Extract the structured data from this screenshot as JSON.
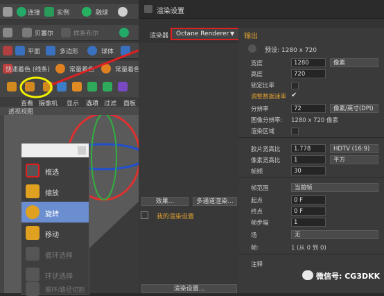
{
  "toolbar": {
    "row1": [
      "连接",
      "实例",
      "融球"
    ],
    "row2": [
      "贝塞尔",
      "样条布尔",
      "样条矢量化"
    ],
    "row3": [
      "平面",
      "多边形",
      "球体"
    ],
    "row4": [
      "快速着色 (线条)",
      "常量着色",
      "常量着色"
    ],
    "menu": [
      "查看",
      "摄像机",
      "显示",
      "选项",
      "过滤",
      "面板"
    ],
    "viewport_label": "透视视图"
  },
  "context_menu": {
    "items": [
      "框选",
      "缩放",
      "旋转",
      "移动",
      "循环选择",
      "环状选择",
      "循环/路径切割"
    ],
    "active_index": 2
  },
  "window": {
    "title": "渲染设置",
    "renderer_label": "渲染器",
    "renderer_value": "Octane Renderer",
    "left_list": [
      {
        "label": "输出",
        "checked": false,
        "highlight": true
      },
      {
        "label": "保存",
        "checked": true,
        "highlight": true
      },
      {
        "label": "多通道",
        "checked": false,
        "highlight": false
      },
      {
        "label": "抗锯齿",
        "checked": false,
        "highlight": false
      },
      {
        "label": "选项",
        "checked": false,
        "highlight": false
      },
      {
        "label": "立体",
        "checked": false,
        "highlight": false
      },
      {
        "label": "Team Render",
        "checked": false,
        "highlight": false
      },
      {
        "label": "材质覆写",
        "checked": false,
        "highlight": false
      },
      {
        "label": "Octane Renderer",
        "checked": false,
        "highlight": false
      }
    ],
    "effects_button": "效果...",
    "multipass_button": "多通道渲染...",
    "my_settings": "我的渲染设置",
    "render_settings_button": "渲染设置...",
    "output_header": "输出",
    "preset": "预设: 1280 x 720",
    "width_label": "宽度",
    "width_value": "1280",
    "width_unit": "像素",
    "height_label": "高度",
    "height_value": "720",
    "lock_ratio_label": "锁定比率",
    "adjust_label": "调整数据速率",
    "resolution_label": "分辨率",
    "resolution_value": "72",
    "resolution_unit": "像素/英寸(DPI)",
    "image_res_label": "图像分辨率:",
    "image_res_value": "1280 x 720 像素",
    "render_region_label": "渲染区域",
    "film_aspect_label": "胶片宽高比",
    "film_aspect_value": "1.778",
    "film_aspect_preset": "HDTV (16:9)",
    "pixel_aspect_label": "像素宽高比",
    "pixel_aspect_value": "1",
    "pixel_aspect_preset": "平方",
    "fps_label": "帧频",
    "fps_value": "30",
    "frame_range_label": "帧范围",
    "frame_range_value": "当前帧",
    "start_label": "起点",
    "start_value": "0 F",
    "end_label": "终点",
    "end_value": "0 F",
    "step_label": "帧步幅",
    "step_value": "1",
    "field_label": "场",
    "field_value": "无",
    "frames_label": "帧:",
    "frames_value": "1 (从 0 到 0)",
    "notes_label": "注释"
  },
  "watermark": "微信号: CG3DKK",
  "colors": {
    "highlight_orange": "#e0a030",
    "annot_red": "#e02020",
    "annot_yellow": "#f0f000"
  }
}
